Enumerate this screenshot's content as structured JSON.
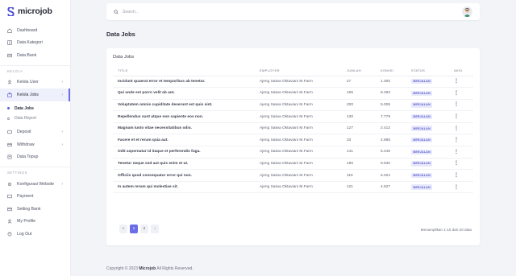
{
  "brand": {
    "name": "microjob"
  },
  "sidebar": {
    "top_items": [
      {
        "label": "Dashboard",
        "icon": "home-icon"
      },
      {
        "label": "Data Kategori",
        "icon": "grid-icon"
      },
      {
        "label": "Data Bank",
        "icon": "bank-icon"
      }
    ],
    "section_kelola": "KELOLA",
    "kelola_items": [
      {
        "label": "Kelola User",
        "icon": "user-icon",
        "chevron": "›"
      },
      {
        "label": "Kelola Jobs",
        "icon": "briefcase-icon",
        "chevron": "›"
      }
    ],
    "sub_items": [
      {
        "label": "Data Jobs"
      },
      {
        "label": "Data Report"
      }
    ],
    "more_items": [
      {
        "label": "Deposit",
        "icon": "deposit-icon",
        "chevron": "›"
      },
      {
        "label": "Withdraw",
        "icon": "withdraw-icon",
        "chevron": "›"
      },
      {
        "label": "Data Topup",
        "icon": "topup-icon"
      }
    ],
    "section_settings": "SETTINGS",
    "settings_items": [
      {
        "label": "Konfigurasi Website",
        "icon": "gear-icon",
        "chevron": "›"
      },
      {
        "label": "Payment",
        "icon": "payment-icon"
      },
      {
        "label": "Setting Bank",
        "icon": "bank-icon"
      },
      {
        "label": "My Profile",
        "icon": "profile-icon"
      },
      {
        "label": "Log Out",
        "icon": "logout-icon"
      }
    ]
  },
  "search": {
    "placeholder": "Search..."
  },
  "page": {
    "title": "Data Jobs"
  },
  "card": {
    "title": "Data Jobs"
  },
  "table": {
    "headers": [
      "TITLE",
      "EMPLOYER",
      "JUMLAH",
      "KOMISI",
      "STATUS",
      "AKSI"
    ],
    "rows": [
      {
        "title": "Incidunt quaerat error et temporibus ab tenetur.",
        "employer": "Ajeng Saiwa Oktaviani M.Farm",
        "jumlah": "27",
        "komisi": "1.300",
        "status": "BERJALAN",
        "aksi": "⋮"
      },
      {
        "title": "Qui unde est porro velit ab aut.",
        "employer": "Ajeng Saiwa Oktaviani M.Farm",
        "jumlah": "165",
        "komisi": "8.483",
        "status": "BERJALAN",
        "aksi": "⋮"
      },
      {
        "title": "Voluptatem omnis cupiditate deserunt est quis sint.",
        "employer": "Ajeng Saiwa Oktaviani M.Farm",
        "jumlah": "200",
        "komisi": "5.006",
        "status": "BERJALAN",
        "aksi": "⋮"
      },
      {
        "title": "Repellendus sunt atque non sapiente eos non.",
        "employer": "Ajeng Saiwa Oktaviani M.Farm",
        "jumlah": "130",
        "komisi": "7.779",
        "status": "BERJALAN",
        "aksi": "⋮"
      },
      {
        "title": "Magnam iusto vitae necessitatibus odio.",
        "employer": "Ajeng Saiwa Oktaviani M.Farm",
        "jumlah": "127",
        "komisi": "2.412",
        "status": "BERJALAN",
        "aksi": "⋮"
      },
      {
        "title": "Facere et et rerum quia aut.",
        "employer": "Ajeng Saiwa Oktaviani M.Farm",
        "jumlah": "33",
        "komisi": "4.885",
        "status": "BERJALAN",
        "aksi": "⋮"
      },
      {
        "title": "Odit aspernatur id itaque et perferendis fuga.",
        "employer": "Ajeng Saiwa Oktaviani M.Farm",
        "jumlah": "141",
        "komisi": "5.446",
        "status": "BERJALAN",
        "aksi": "⋮"
      },
      {
        "title": "Tenetur neque sed aut quis enim et ut.",
        "employer": "Ajeng Saiwa Oktaviani M.Farm",
        "jumlah": "190",
        "komisi": "9.630",
        "status": "BERJALAN",
        "aksi": "⋮"
      },
      {
        "title": "Officiis quod consequatur error qui non.",
        "employer": "Ajeng Saiwa Oktaviani M.Farm",
        "jumlah": "116",
        "komisi": "6.024",
        "status": "BERJALAN",
        "aksi": "⋮"
      },
      {
        "title": "In autem rerum qui molestiae sit.",
        "employer": "Ajeng Saiwa Oktaviani M.Farm",
        "jumlah": "121",
        "komisi": "4.627",
        "status": "BERJALAN",
        "aksi": "⋮"
      }
    ]
  },
  "pagination": {
    "prev": "«",
    "pages": [
      "1",
      "2"
    ],
    "next": "›",
    "summary": "Menampilkan 1-10 dari 20 data"
  },
  "footer": {
    "prefix": "Copyright © 2023",
    "brand": "Microjob",
    "suffix": "All Rights Reserved."
  },
  "colors": {
    "accent": "#6c6ee8",
    "badge_bg": "#e8e9fd",
    "badge_text": "#5456c7"
  }
}
